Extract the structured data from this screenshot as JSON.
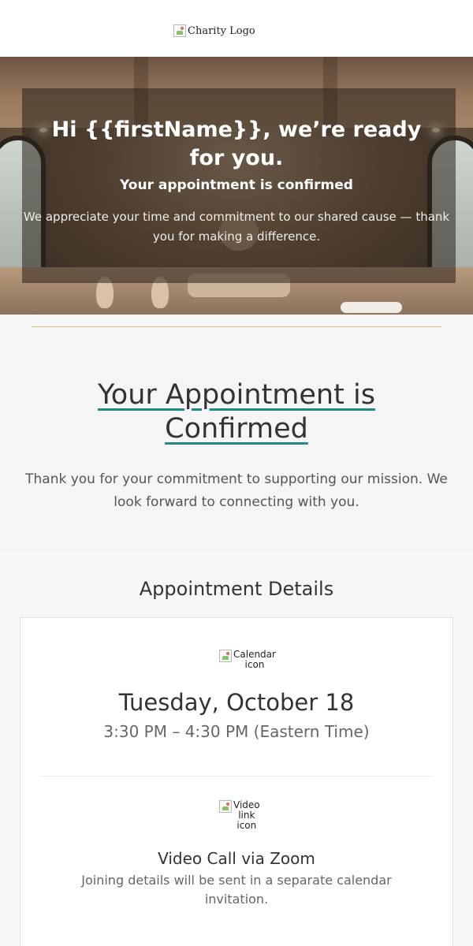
{
  "header": {
    "logo_alt": "Charity Logo"
  },
  "hero": {
    "greeting": "Hi {{firstName}}, we’re ready for you.",
    "subheading": "Your appointment is confirmed",
    "message": "We appreciate your time and commitment to our shared cause — thank you for making a difference."
  },
  "confirmation": {
    "title": "Your Appointment is Confirmed",
    "body": "Thank you for your commitment to supporting our mission. We look forward to connecting with you."
  },
  "details": {
    "title": "Appointment Details",
    "calendar_icon_alt": "Calendar icon",
    "date": "Tuesday, October 18",
    "time": "3:30 PM – 4:30 PM (Eastern Time)",
    "video_icon_alt": "Video link icon",
    "video_title": "Video Call via Zoom",
    "video_desc": "Joining details will be sent in a separate calendar invitation."
  },
  "colors": {
    "accent": "#1f8a87",
    "divider": "#d4c08a"
  }
}
